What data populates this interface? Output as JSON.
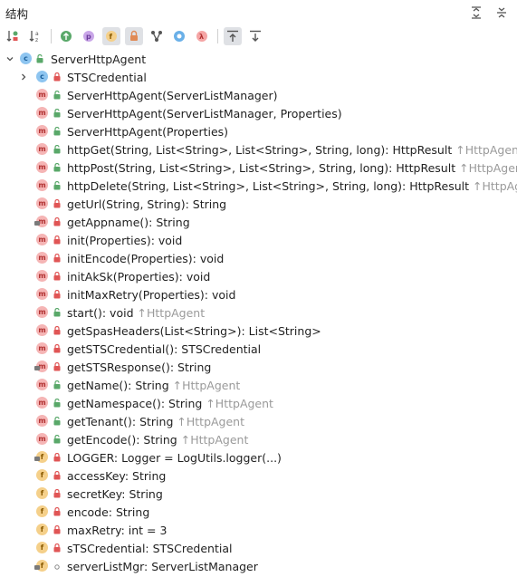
{
  "header": {
    "title": "结构"
  },
  "tree": {
    "root": {
      "label": "ServerHttpAgent"
    },
    "items": [
      {
        "kind": "c",
        "vis": "lock",
        "label": "STSCredential",
        "inherited": "",
        "expandable": true
      },
      {
        "kind": "m",
        "vis": "open",
        "label": "ServerHttpAgent(ServerListManager)",
        "inherited": ""
      },
      {
        "kind": "m",
        "vis": "open",
        "label": "ServerHttpAgent(ServerListManager, Properties)",
        "inherited": ""
      },
      {
        "kind": "m",
        "vis": "open",
        "label": "ServerHttpAgent(Properties)",
        "inherited": ""
      },
      {
        "kind": "m",
        "vis": "open",
        "label": "httpGet(String, List<String>, List<String>, String, long): HttpResult",
        "inherited": "↑HttpAgent"
      },
      {
        "kind": "m",
        "vis": "open",
        "label": "httpPost(String, List<String>, List<String>, String, long): HttpResult",
        "inherited": "↑HttpAgent"
      },
      {
        "kind": "m",
        "vis": "open",
        "label": "httpDelete(String, List<String>, List<String>, String, long): HttpResult",
        "inherited": "↑HttpAgent"
      },
      {
        "kind": "m",
        "vis": "lock",
        "label": "getUrl(String, String): String",
        "inherited": ""
      },
      {
        "kind": "m",
        "vis": "lock",
        "label": "getAppname(): String",
        "inherited": "",
        "static": true
      },
      {
        "kind": "m",
        "vis": "lock",
        "label": "init(Properties): void",
        "inherited": ""
      },
      {
        "kind": "m",
        "vis": "lock",
        "label": "initEncode(Properties): void",
        "inherited": ""
      },
      {
        "kind": "m",
        "vis": "lock",
        "label": "initAkSk(Properties): void",
        "inherited": ""
      },
      {
        "kind": "m",
        "vis": "lock",
        "label": "initMaxRetry(Properties): void",
        "inherited": ""
      },
      {
        "kind": "m",
        "vis": "open",
        "label": "start(): void",
        "inherited": "↑HttpAgent"
      },
      {
        "kind": "m",
        "vis": "lock",
        "label": "getSpasHeaders(List<String>): List<String>",
        "inherited": ""
      },
      {
        "kind": "m",
        "vis": "lock",
        "label": "getSTSCredential(): STSCredential",
        "inherited": ""
      },
      {
        "kind": "m",
        "vis": "lock",
        "label": "getSTSResponse(): String",
        "inherited": "",
        "static": true
      },
      {
        "kind": "m",
        "vis": "open",
        "label": "getName(): String",
        "inherited": "↑HttpAgent"
      },
      {
        "kind": "m",
        "vis": "open",
        "label": "getNamespace(): String",
        "inherited": "↑HttpAgent"
      },
      {
        "kind": "m",
        "vis": "open",
        "label": "getTenant(): String",
        "inherited": "↑HttpAgent"
      },
      {
        "kind": "m",
        "vis": "open",
        "label": "getEncode(): String",
        "inherited": "↑HttpAgent"
      },
      {
        "kind": "f",
        "vis": "lock",
        "label": "LOGGER: Logger = LogUtils.logger(...)",
        "inherited": "",
        "static": true
      },
      {
        "kind": "f",
        "vis": "lock",
        "label": "accessKey: String",
        "inherited": ""
      },
      {
        "kind": "f",
        "vis": "lock",
        "label": "secretKey: String",
        "inherited": ""
      },
      {
        "kind": "f",
        "vis": "lock",
        "label": "encode: String",
        "inherited": ""
      },
      {
        "kind": "f",
        "vis": "lock",
        "label": "maxRetry: int = 3",
        "inherited": ""
      },
      {
        "kind": "f",
        "vis": "lock",
        "label": "sTSCredential: STSCredential",
        "inherited": ""
      },
      {
        "kind": "f",
        "vis": "package",
        "label": "serverListMgr: ServerListManager",
        "inherited": "",
        "static": true
      }
    ]
  },
  "colors": {
    "method_badge": "#f5b5b5",
    "field_badge": "#f5d08a",
    "class_badge": "#8ec5f0",
    "public_green": "#59a869",
    "private_red": "#e05555",
    "inherited_text": "#9a9a9a"
  },
  "icons": {
    "header": [
      "expand-all-icon",
      "collapse-all-icon"
    ],
    "toolbar": [
      "sort-by-visibility-icon",
      "sort-alphabetically-icon",
      "show-inherited-icon",
      "show-properties-icon",
      "show-fields-icon",
      "show-non-public-icon",
      "show-lambdas-tree-icon",
      "show-anonymous-icon",
      "show-lambdas-icon",
      "autoscroll-to-source-icon",
      "autoscroll-from-source-icon"
    ]
  }
}
